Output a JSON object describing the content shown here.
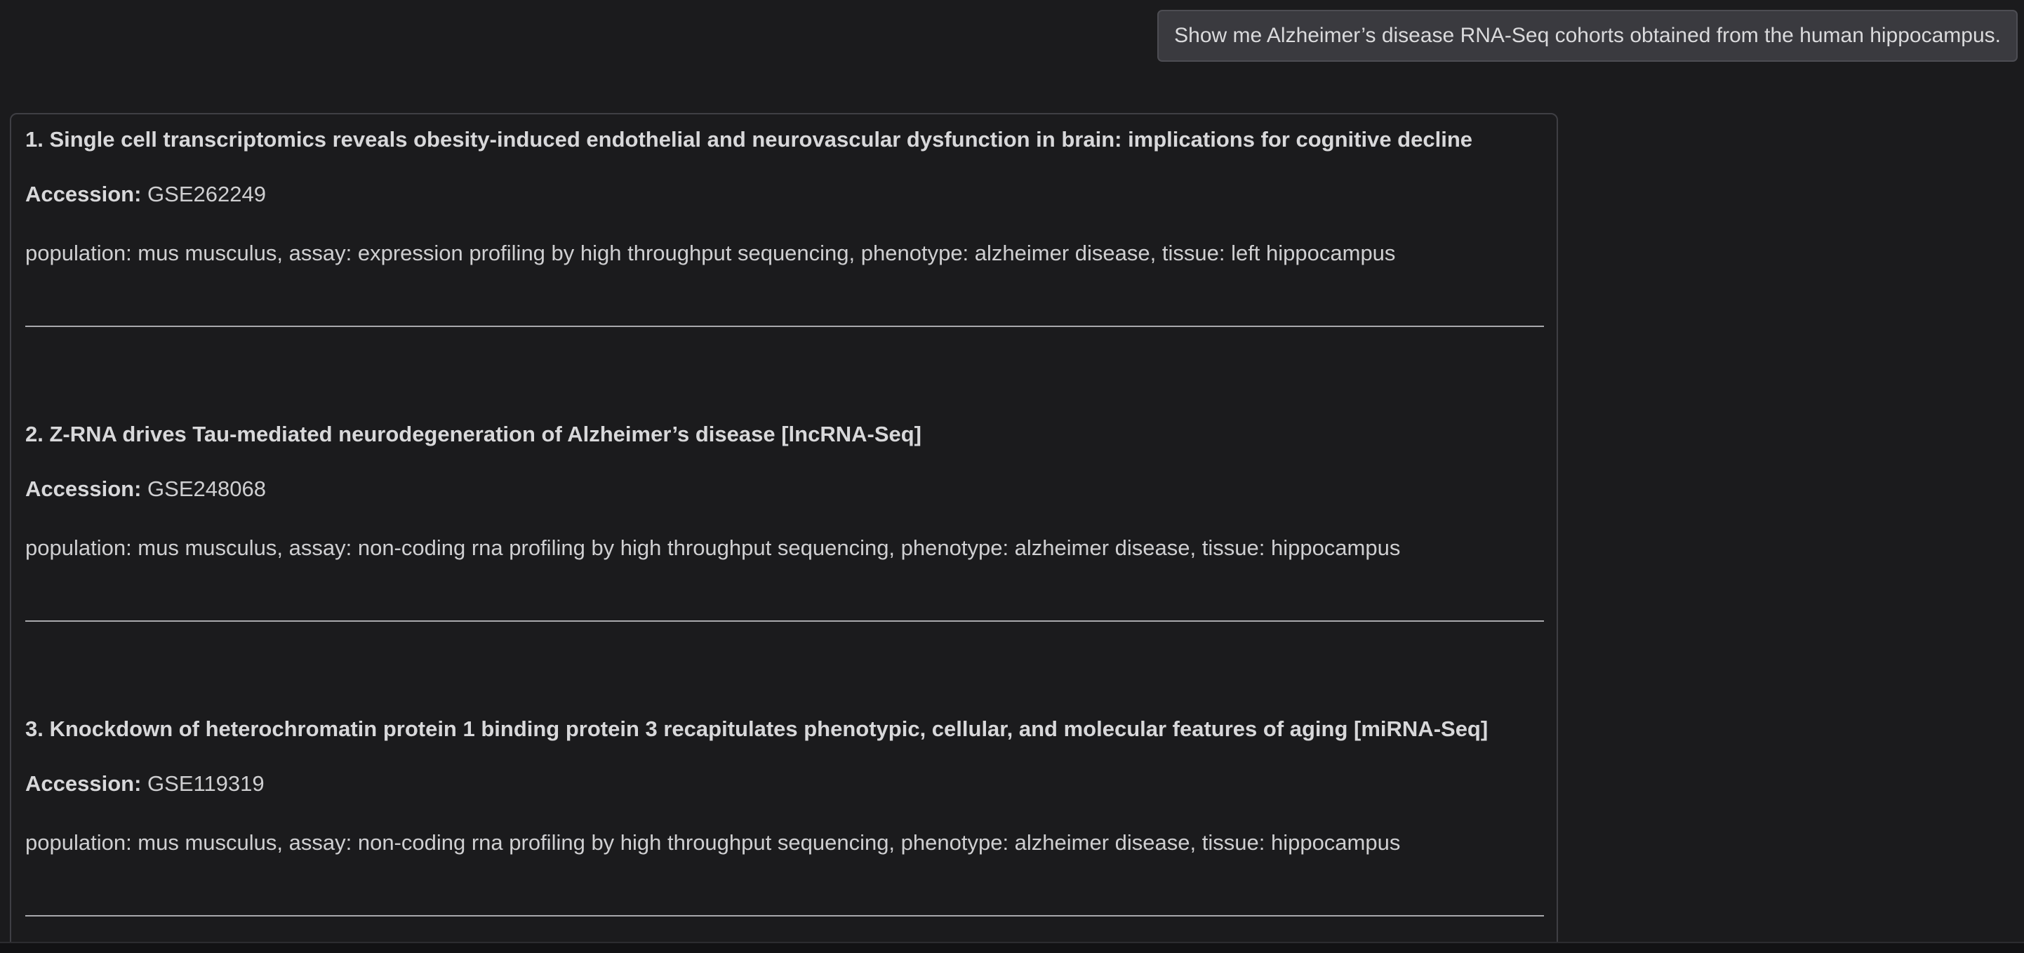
{
  "user_message": "Show me Alzheimer’s disease RNA-Seq cohorts obtained from the human hippocampus.",
  "results": [
    {
      "title": "1. Single cell transcriptomics reveals obesity-induced endothelial and neurovascular dysfunction in brain: implications for cognitive decline",
      "accession_label": "Accession:",
      "accession": "GSE262249",
      "meta": "population: mus musculus, assay: expression profiling by high throughput sequencing, phenotype: alzheimer disease, tissue: left hippocampus"
    },
    {
      "title": "2. Z-RNA drives Tau-mediated neurodegeneration of Alzheimer’s disease [lncRNA-Seq]",
      "accession_label": "Accession:",
      "accession": "GSE248068",
      "meta": "population: mus musculus, assay: non-coding rna profiling by high throughput sequencing, phenotype: alzheimer disease, tissue: hippocampus"
    },
    {
      "title": "3. Knockdown of heterochromatin protein 1 binding protein 3 recapitulates phenotypic, cellular, and molecular features of aging [miRNA-Seq]",
      "accession_label": "Accession:",
      "accession": "GSE119319",
      "meta": "population: mus musculus, assay: non-coding rna profiling by high throughput sequencing, phenotype: alzheimer disease, tissue: hippocampus"
    }
  ]
}
